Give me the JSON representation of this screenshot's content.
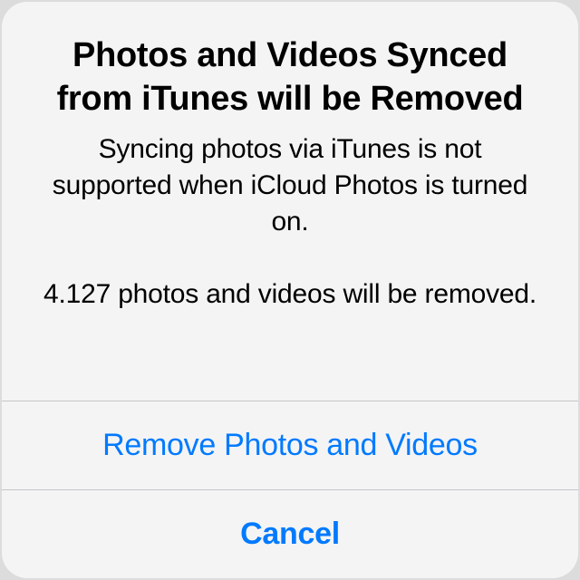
{
  "alert": {
    "title": "Photos and Videos Synced from iTunes will be Removed",
    "message": "Syncing photos via iTunes is not supported when iCloud Photos is turned on.\n\n4.127 photos and videos will be removed.",
    "primary_action": "Remove Photos and Videos",
    "cancel_action": "Cancel"
  },
  "colors": {
    "button_text": "#007aff",
    "background": "#f4f4f5",
    "separator": "#c6c6c8"
  }
}
